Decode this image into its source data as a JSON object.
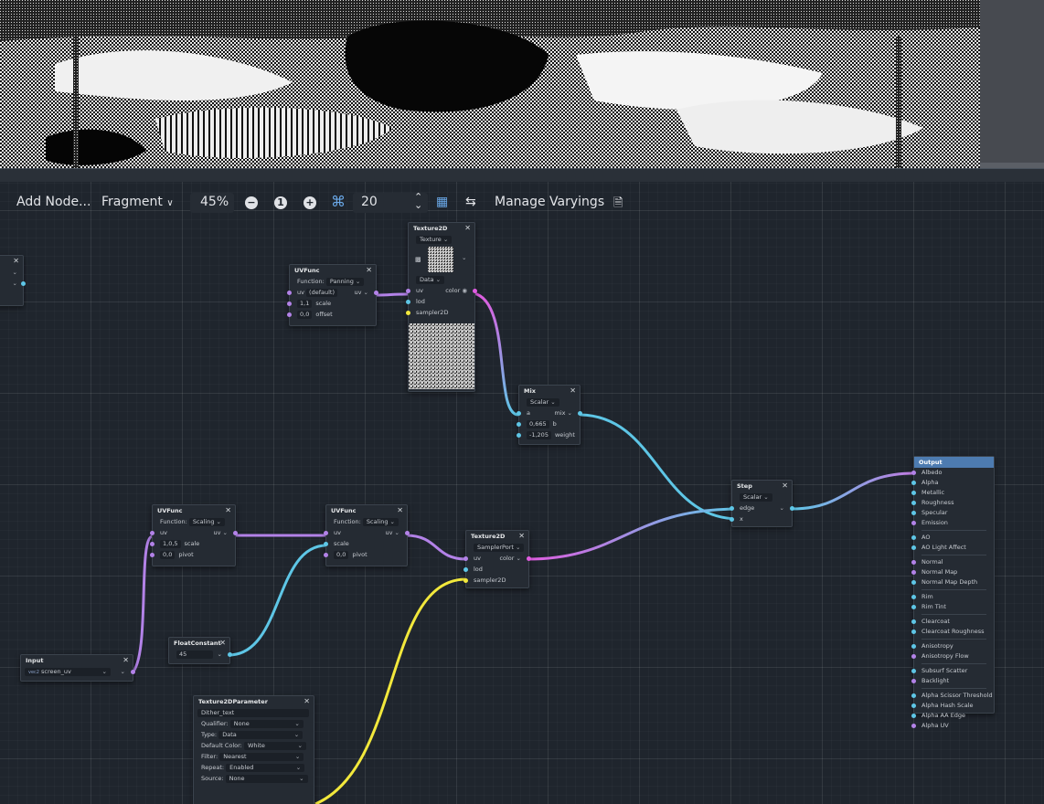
{
  "toolbar": {
    "add_node": "Add Node...",
    "mode": "Fragment",
    "zoom": "45%",
    "snap_distance": "20",
    "manage_varyings": "Manage Varyings",
    "icons": [
      "zoom-out-icon",
      "zoom-reset-icon",
      "zoom-in-icon",
      "snap-grid-icon",
      "spinner-icon",
      "minimap-icon",
      "arrange-icon",
      "docs-icon"
    ]
  },
  "colors": {
    "uv": "#b382e8",
    "scalar": "#5ec6e6",
    "sampler": "#f2e83c",
    "vec4": "#e05ce0",
    "output_header": "#4d7bb0"
  },
  "nodes": {
    "texture2d_top": {
      "title": "Texture2D",
      "source": "Texture",
      "data": "Data",
      "in_uv": "uv",
      "in_lod": "lod",
      "in_sampler": "sampler2D",
      "out": "color"
    },
    "uvfunc_top": {
      "title": "UVFunc",
      "function_label": "Function:",
      "function": "Panning",
      "uv": "uv",
      "uv_default": "(default)",
      "scale_value": "1,1",
      "scale": "scale",
      "offset_value": "0,0",
      "offset": "offset",
      "out": "uv"
    },
    "mix": {
      "title": "Mix",
      "type": "Scalar",
      "a": "a",
      "b_value": "0,665",
      "b": "b",
      "weight_value": "-1,205",
      "weight": "weight",
      "out": "mix"
    },
    "step": {
      "title": "Step",
      "type": "Scalar",
      "edge": "edge",
      "x": "x"
    },
    "uvfunc_left": {
      "title": "UVFunc",
      "function_label": "Function:",
      "function": "Scaling",
      "uv": "uv",
      "scale_value": "1,0,5",
      "scale": "scale",
      "pivot_value": "0,0",
      "pivot": "pivot",
      "out": "uv"
    },
    "uvfunc_mid": {
      "title": "UVFunc",
      "function_label": "Function:",
      "function": "Scaling",
      "uv": "uv",
      "scale": "scale",
      "pivot_value": "0,0",
      "pivot": "pivot",
      "out": "uv"
    },
    "texture2d_mid": {
      "title": "Texture2D",
      "source": "SamplerPort",
      "in_uv": "uv",
      "in_lod": "lod",
      "in_sampler": "sampler2D",
      "out": "color"
    },
    "floatconstant": {
      "title": "FloatConstant",
      "value": "45"
    },
    "input": {
      "title": "Input",
      "value": "screen_uv",
      "tag": "vec2"
    },
    "texture2dparam": {
      "title": "Texture2DParameter",
      "name": "Dither_text",
      "qualifier_label": "Qualifier:",
      "qualifier": "None",
      "type_label": "Type:",
      "type": "Data",
      "default_color_label": "Default Color:",
      "default_color": "White",
      "filter_label": "Filter:",
      "filter": "Nearest",
      "repeat_label": "Repeat:",
      "repeat": "Enabled",
      "source_label": "Source:",
      "source": "None"
    },
    "output": {
      "title": "Output",
      "ports": [
        "Albedo",
        "Alpha",
        "Metallic",
        "Roughness",
        "Specular",
        "Emission",
        "AO",
        "AO Light Affect",
        "Normal",
        "Normal Map",
        "Normal Map Depth",
        "Rim",
        "Rim Tint",
        "Clearcoat",
        "Clearcoat Roughness",
        "Anisotropy",
        "Anisotropy Flow",
        "Subsurf Scatter",
        "Backlight",
        "Alpha Scissor Threshold",
        "Alpha Hash Scale",
        "Alpha AA Edge",
        "Alpha UV"
      ]
    }
  }
}
